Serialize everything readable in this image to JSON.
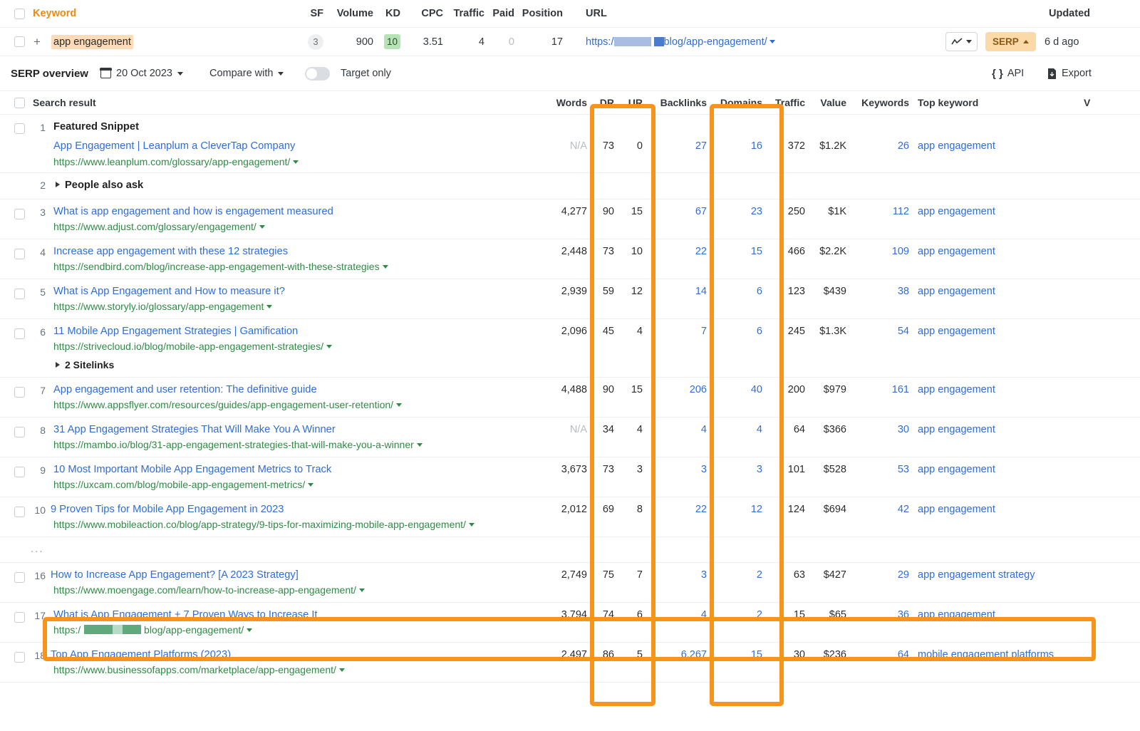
{
  "keyword_table": {
    "headers": {
      "keyword": "Keyword",
      "sf": "SF",
      "volume": "Volume",
      "kd": "KD",
      "cpc": "CPC",
      "traffic": "Traffic",
      "paid": "Paid",
      "position": "Position",
      "url": "URL",
      "updated": "Updated"
    },
    "row": {
      "keyword": "app engagement",
      "sf": "3",
      "volume": "900",
      "kd": "10",
      "cpc": "3.51",
      "traffic": "4",
      "paid": "0",
      "position": "17",
      "url_prefix": "https:/",
      "url_suffix": "blog/app-engagement/",
      "serp_button": "SERP",
      "updated": "6 d ago"
    }
  },
  "overview_bar": {
    "title": "SERP overview",
    "date": "20 Oct 2023",
    "compare": "Compare with",
    "target_only": "Target only",
    "api": "API",
    "export": "Export"
  },
  "serp_table": {
    "headers": {
      "search_result": "Search result",
      "words": "Words",
      "dr": "DR",
      "ur": "UR",
      "backlinks": "Backlinks",
      "domains": "Domains",
      "traffic": "Traffic",
      "value": "Value",
      "keywords": "Keywords",
      "top_keyword": "Top keyword",
      "volume_truncated": "V"
    },
    "ellipsis": "...",
    "rows": [
      {
        "rank": "1",
        "label": "Featured Snippet",
        "title": "App Engagement | Leanplum a CleverTap Company",
        "url": "https://www.leanplum.com/glossary/app-engagement/",
        "words": "N/A",
        "dr": "73",
        "ur": "0",
        "backlinks": "27",
        "domains": "16",
        "traffic": "372",
        "value": "$1.2K",
        "keywords": "26",
        "top_keyword": "app engagement"
      },
      {
        "rank": "2",
        "label": "People also ask"
      },
      {
        "rank": "3",
        "title": "What is app engagement and how is engagement measured",
        "url": "https://www.adjust.com/glossary/engagement/",
        "words": "4,277",
        "dr": "90",
        "ur": "15",
        "backlinks": "67",
        "domains": "23",
        "traffic": "250",
        "value": "$1K",
        "keywords": "112",
        "top_keyword": "app engagement"
      },
      {
        "rank": "4",
        "title": "Increase app engagement with these 12 strategies",
        "url": "https://sendbird.com/blog/increase-app-engagement-with-these-strategies",
        "words": "2,448",
        "dr": "73",
        "ur": "10",
        "backlinks": "22",
        "domains": "15",
        "traffic": "466",
        "value": "$2.2K",
        "keywords": "109",
        "top_keyword": "app engagement"
      },
      {
        "rank": "5",
        "title": "What is App Engagement and How to measure it?",
        "url": "https://www.storyly.io/glossary/app-engagement",
        "words": "2,939",
        "dr": "59",
        "ur": "12",
        "backlinks": "14",
        "domains": "6",
        "traffic": "123",
        "value": "$439",
        "keywords": "38",
        "top_keyword": "app engagement"
      },
      {
        "rank": "6",
        "title": "11 Mobile App Engagement Strategies | Gamification",
        "url": "https://strivecloud.io/blog/mobile-app-engagement-strategies/",
        "sitelinks": "2 Sitelinks",
        "words": "2,096",
        "dr": "45",
        "ur": "4",
        "backlinks": "7",
        "domains": "6",
        "traffic": "245",
        "value": "$1.3K",
        "keywords": "54",
        "top_keyword": "app engagement"
      },
      {
        "rank": "7",
        "title": "App engagement and user retention: The definitive guide",
        "url": "https://www.appsflyer.com/resources/guides/app-engagement-user-retention/",
        "words": "4,488",
        "dr": "90",
        "ur": "15",
        "backlinks": "206",
        "domains": "40",
        "traffic": "200",
        "value": "$979",
        "keywords": "161",
        "top_keyword": "app engagement"
      },
      {
        "rank": "8",
        "title": "31 App Engagement Strategies That Will Make You A Winner",
        "url": "https://mambo.io/blog/31-app-engagement-strategies-that-will-make-you-a-winner",
        "words": "N/A",
        "dr": "34",
        "ur": "4",
        "backlinks": "4",
        "domains": "4",
        "traffic": "64",
        "value": "$366",
        "keywords": "30",
        "top_keyword": "app engagement"
      },
      {
        "rank": "9",
        "title": "10 Most Important Mobile App Engagement Metrics to Track",
        "url": "https://uxcam.com/blog/mobile-app-engagement-metrics/",
        "words": "3,673",
        "dr": "73",
        "ur": "3",
        "backlinks": "3",
        "domains": "3",
        "traffic": "101",
        "value": "$528",
        "keywords": "53",
        "top_keyword": "app engagement"
      },
      {
        "rank": "10",
        "title": "9 Proven Tips for Mobile App Engagement in 2023",
        "url": "https://www.mobileaction.co/blog/app-strategy/9-tips-for-maximizing-mobile-app-engagement/",
        "words": "2,012",
        "dr": "69",
        "ur": "8",
        "backlinks": "22",
        "domains": "12",
        "traffic": "124",
        "value": "$694",
        "keywords": "42",
        "top_keyword": "app engagement"
      },
      {
        "rank": "16",
        "title": "How to Increase App Engagement? [A 2023 Strategy]",
        "url": "https://www.moengage.com/learn/how-to-increase-app-engagement/",
        "words": "2,749",
        "dr": "75",
        "ur": "7",
        "backlinks": "3",
        "domains": "2",
        "traffic": "63",
        "value": "$427",
        "keywords": "29",
        "top_keyword": "app engagement strategy"
      },
      {
        "rank": "17",
        "title": "What is App Engagement + 7 Proven Ways to Increase It",
        "url_prefix": "https:/",
        "url_suffix": "blog/app-engagement/",
        "words": "3,794",
        "dr": "74",
        "ur": "6",
        "backlinks": "4",
        "domains": "2",
        "traffic": "15",
        "value": "$65",
        "keywords": "36",
        "top_keyword": "app engagement"
      },
      {
        "rank": "18",
        "title": "Top App Engagement Platforms (2023)",
        "url": "https://www.businessofapps.com/marketplace/app-engagement/",
        "words": "2,497",
        "dr": "86",
        "ur": "5",
        "backlinks": "6,267",
        "domains": "15",
        "traffic": "30",
        "value": "$236",
        "keywords": "64",
        "top_keyword": "mobile engagement platforms"
      }
    ]
  },
  "colors": {
    "accent_orange": "#f7941d",
    "link_blue": "#2f6ddb",
    "url_green": "#2e8b45",
    "kd_green": "#b6e3b6"
  }
}
